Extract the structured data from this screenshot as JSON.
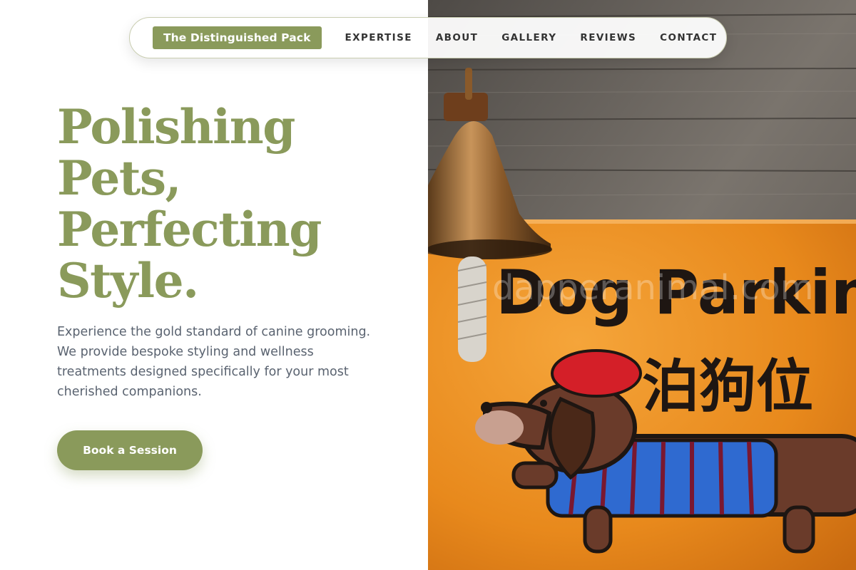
{
  "nav": {
    "brand": "The Distinguished Pack",
    "links": [
      "EXPERTISE",
      "ABOUT",
      "GALLERY",
      "REVIEWS",
      "CONTACT"
    ]
  },
  "hero": {
    "title_lines": [
      "Polishing",
      "Pets,",
      "Perfecting",
      "Style."
    ],
    "description": "Experience the gold standard of canine grooming. We provide bespoke styling and wellness treatments designed specifically for your most cherished companions.",
    "cta_label": "Book a Session"
  },
  "photo": {
    "sign_text": "Dog Parking",
    "sign_text_cn": "泊狗位",
    "watermark": "dapperanimal.com"
  },
  "colors": {
    "accent": "#8a9a5b",
    "body_text": "#5a6370",
    "nav_text": "#333333",
    "sign_orange": "#e8891c"
  }
}
